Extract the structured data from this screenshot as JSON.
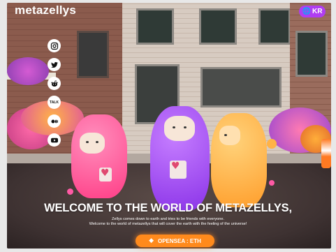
{
  "header": {
    "logo_text": "metazellys",
    "language_button": {
      "label": "KR",
      "icon": "globe-icon"
    }
  },
  "social_links": [
    {
      "name": "instagram-icon"
    },
    {
      "name": "twitter-icon"
    },
    {
      "name": "reddit-icon"
    },
    {
      "name": "talk-icon",
      "label": "TALK"
    },
    {
      "name": "medium-icon"
    },
    {
      "name": "youtube-icon"
    }
  ],
  "hero": {
    "headline": "WELCOME TO THE WORLD OF METAZELLYS,",
    "subline_1": "Zellys comes down to earth and tries to be friends with everyone.",
    "subline_2": "Welcome to the world of metazellys that will cover the earth with the feeling of the universe!"
  },
  "cta": {
    "label": "OPENSEA : ETH",
    "icon": "ethereum-icon"
  },
  "colors": {
    "accent_purple": "#b03df2",
    "cta_orange": "#ff8a1c",
    "zelly_pink": "#ff4f8f",
    "zelly_purple": "#a24ef0",
    "zelly_orange": "#ffae3a"
  }
}
